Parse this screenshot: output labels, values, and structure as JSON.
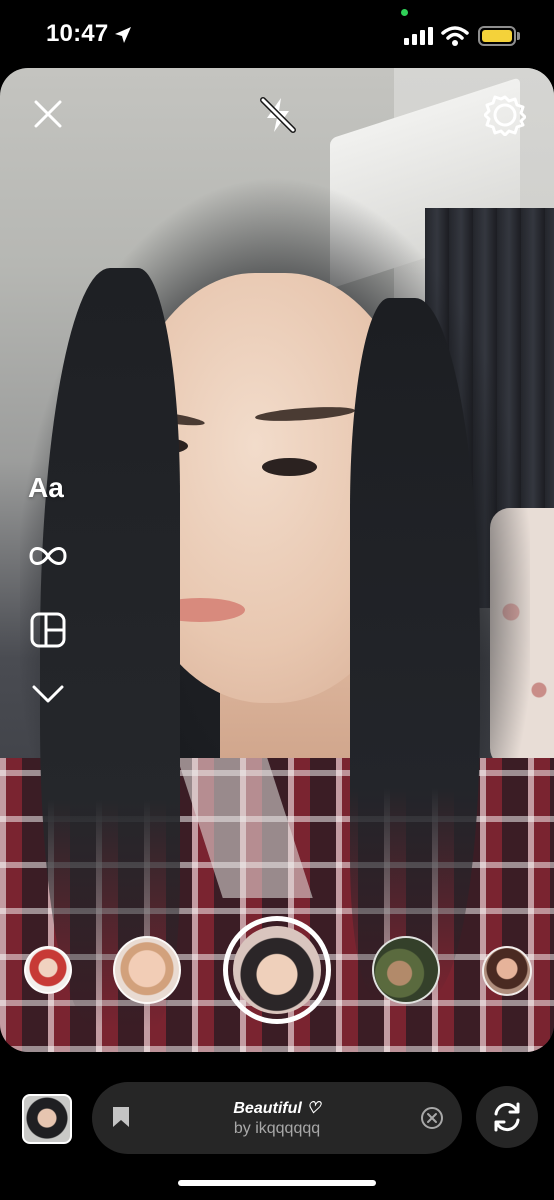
{
  "status_bar": {
    "time": "10:47",
    "battery_level": 1.0,
    "colors": {
      "battery": "#f4d23a",
      "privacy_dot": "#30d158"
    }
  },
  "camera": {
    "top_controls": {
      "close_icon": "close-icon",
      "flash_icon": "flash-off-icon",
      "settings_icon": "gear-icon"
    },
    "side_tools": {
      "create_label": "Aa",
      "boomerang_icon": "infinity-icon",
      "layout_icon": "layout-grid-icon",
      "more_icon": "chevron-down-icon"
    },
    "effects": [
      "effect-thumb-1",
      "effect-thumb-2",
      "shutter-selected",
      "effect-thumb-4",
      "effect-thumb-5"
    ]
  },
  "bottom_bar": {
    "effect_name": "Beautiful ♡",
    "effect_author": "by ikqqqqqq",
    "bookmark_icon": "bookmark-icon",
    "remove_icon": "close-circle-icon",
    "flip_icon": "flip-camera-icon"
  }
}
